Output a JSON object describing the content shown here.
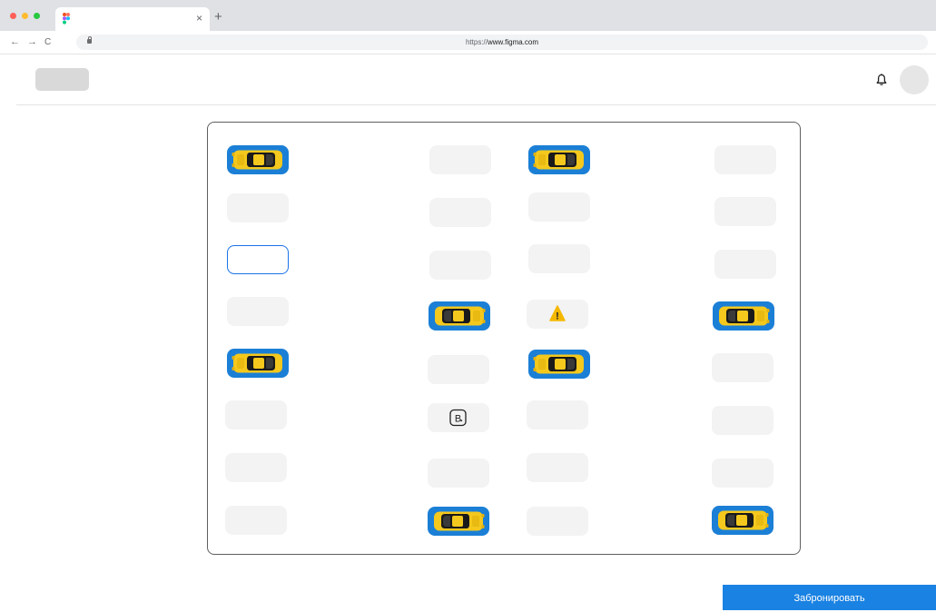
{
  "browser": {
    "url_prefix": "https://",
    "url_domain": "www.figma.com",
    "tab_close": "×",
    "new_tab": "+",
    "back": "←",
    "forward": "→",
    "reload": "C",
    "traffic_colors": [
      "#ff5f57",
      "#febc2e",
      "#28c840"
    ]
  },
  "header": {
    "bell_icon": "bell-icon",
    "avatar": "avatar"
  },
  "parking": {
    "spots": [
      {
        "id": "c1r1",
        "state": "occupied",
        "car": "facing-right"
      },
      {
        "id": "c1r2",
        "state": "free"
      },
      {
        "id": "c1r3",
        "state": "selected"
      },
      {
        "id": "c1r4",
        "state": "free"
      },
      {
        "id": "c1r5",
        "state": "occupied",
        "car": "facing-right"
      },
      {
        "id": "c1r6",
        "state": "free"
      },
      {
        "id": "c1r7",
        "state": "free"
      },
      {
        "id": "c1r8",
        "state": "free"
      },
      {
        "id": "c2r1",
        "state": "free"
      },
      {
        "id": "c2r2",
        "state": "free"
      },
      {
        "id": "c2r3",
        "state": "free"
      },
      {
        "id": "c2r4",
        "state": "occupied",
        "car": "facing-left"
      },
      {
        "id": "c2r5",
        "state": "free"
      },
      {
        "id": "c2r6",
        "state": "booked",
        "icon": "booked-b-icon",
        "label": "B"
      },
      {
        "id": "c2r7",
        "state": "free"
      },
      {
        "id": "c2r8",
        "state": "occupied",
        "car": "facing-left"
      },
      {
        "id": "c3r1",
        "state": "occupied",
        "car": "facing-right"
      },
      {
        "id": "c3r2",
        "state": "free"
      },
      {
        "id": "c3r3",
        "state": "free"
      },
      {
        "id": "c3r4",
        "state": "warning",
        "icon": "warning-icon",
        "label": "!"
      },
      {
        "id": "c3r5",
        "state": "occupied",
        "car": "facing-right"
      },
      {
        "id": "c3r6",
        "state": "free"
      },
      {
        "id": "c3r7",
        "state": "free"
      },
      {
        "id": "c3r8",
        "state": "free"
      },
      {
        "id": "c4r1",
        "state": "free"
      },
      {
        "id": "c4r2",
        "state": "free"
      },
      {
        "id": "c4r3",
        "state": "free"
      },
      {
        "id": "c4r4",
        "state": "occupied",
        "car": "facing-left"
      },
      {
        "id": "c4r5",
        "state": "free"
      },
      {
        "id": "c4r6",
        "state": "free"
      },
      {
        "id": "c4r7",
        "state": "free"
      },
      {
        "id": "c4r8",
        "state": "occupied",
        "car": "facing-left"
      }
    ]
  },
  "actions": {
    "book_label": "Забронировать"
  },
  "colors": {
    "accent": "#1a82e2",
    "occupied": "#1b7fd6",
    "car": "#f4c81d",
    "free": "#f3f3f3",
    "selected_border": "#1a73e8",
    "warning": "#f5b800"
  }
}
